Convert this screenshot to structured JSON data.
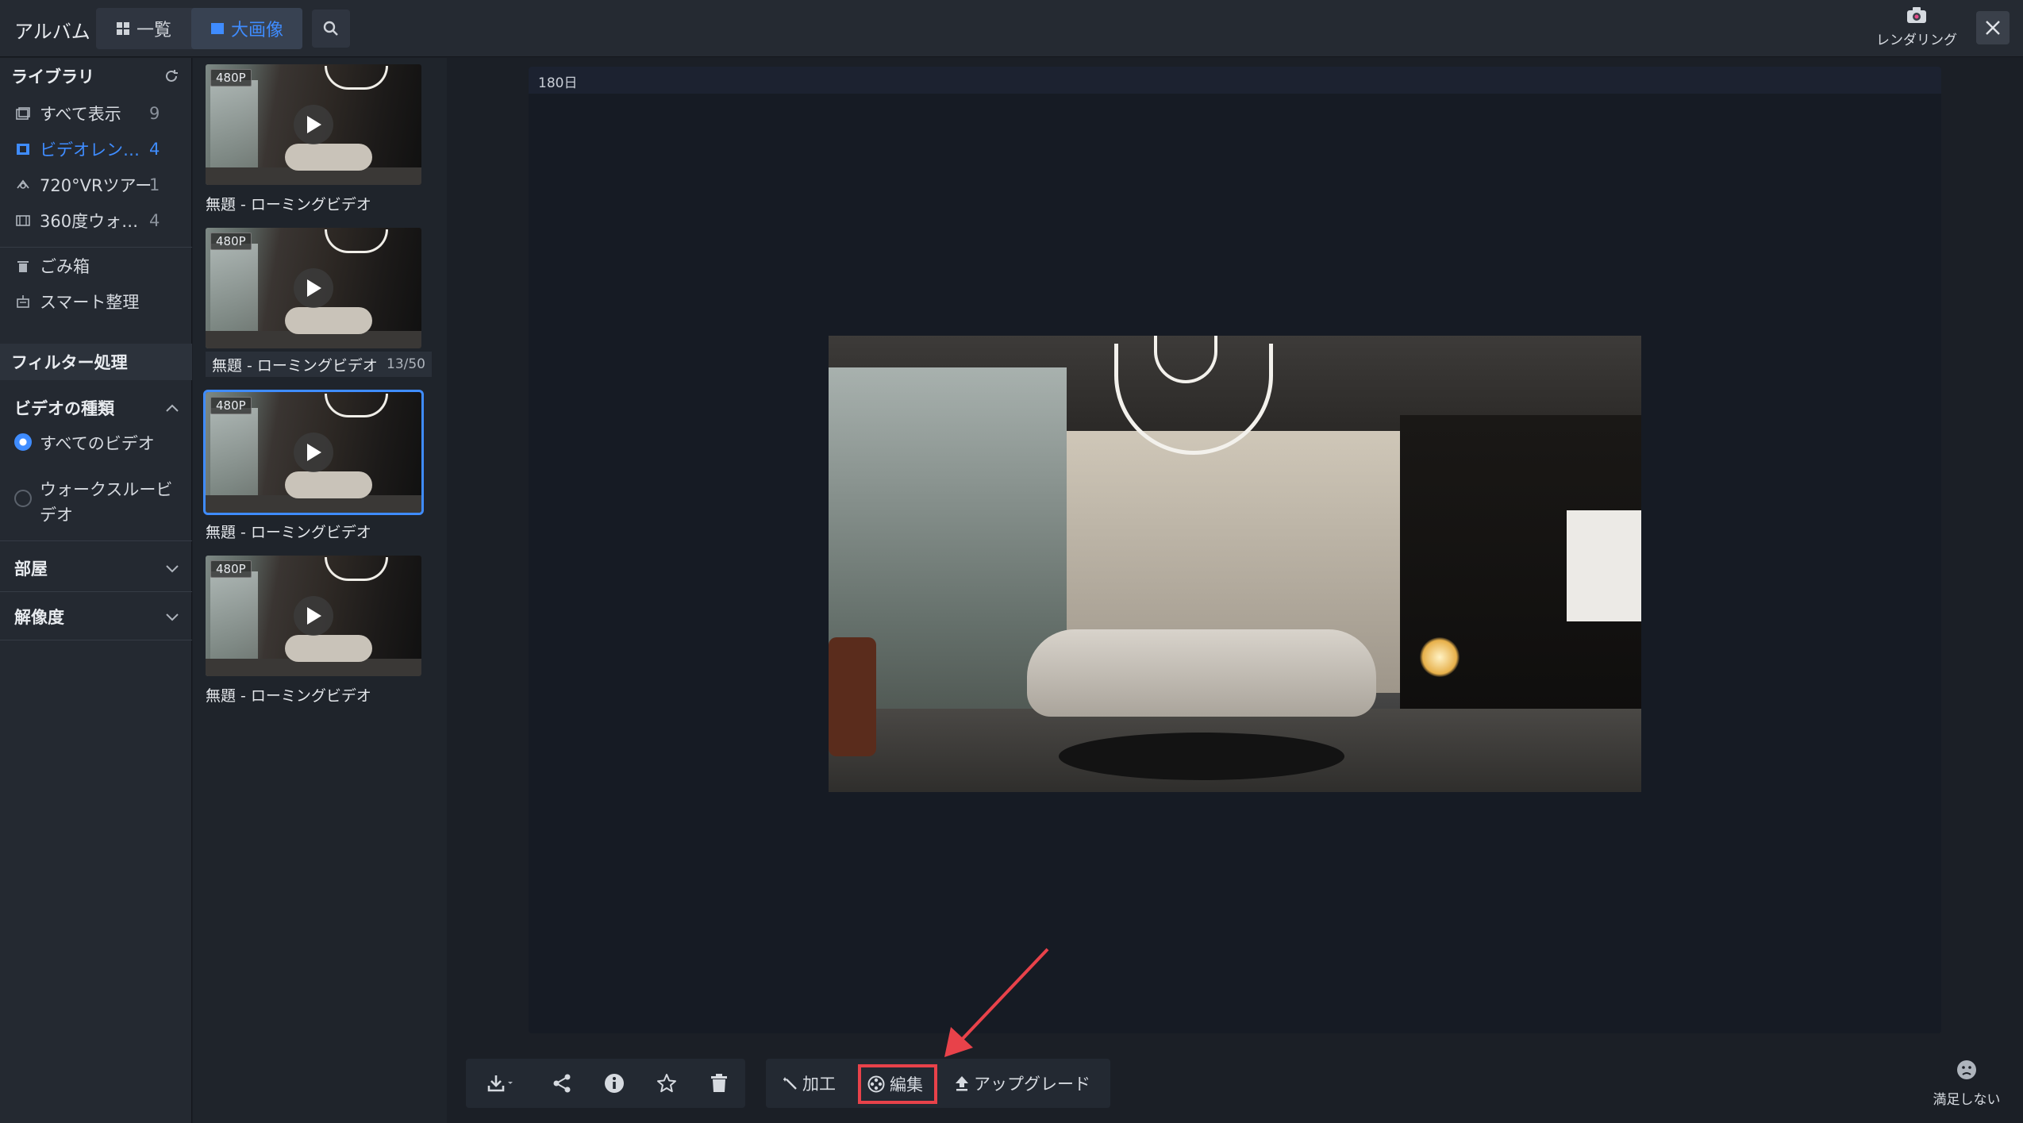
{
  "header": {
    "app_title": "アルバム",
    "view_list_label": "一覧",
    "view_large_label": "大画像",
    "render_label": "レンダリング"
  },
  "sidebar": {
    "library_title": "ライブラリ",
    "library_items": [
      {
        "label": "すべて表示",
        "count": "9",
        "icon": "images-icon"
      },
      {
        "label": "ビデオレン…",
        "count": "4",
        "icon": "film-icon",
        "active": true
      },
      {
        "label": "720°VRツアー",
        "count": "1",
        "icon": "vr-icon"
      },
      {
        "label": "360度ウォ…",
        "count": "4",
        "icon": "panorama-icon"
      }
    ],
    "trash_label": "ごみ箱",
    "smart_label": "スマート整理",
    "filter_title": "フィルター処理",
    "video_type_title": "ビデオの種類",
    "video_type_options": [
      "すべてのビデオ",
      "ウォークスルービデオ"
    ],
    "video_type_selected": "すべてのビデオ",
    "room_title": "部屋",
    "resolution_title": "解像度"
  },
  "thumbnails": [
    {
      "badge": "480P",
      "title": "無題 - ローミングビデオ",
      "page": ""
    },
    {
      "badge": "480P",
      "title": "無題 - ローミングビデオ",
      "page": "13/50"
    },
    {
      "badge": "480P",
      "title": "無題 - ローミングビデオ",
      "page": "",
      "selected": true
    },
    {
      "badge": "480P",
      "title": "無題 - ローミングビデオ",
      "page": ""
    }
  ],
  "viewer": {
    "label": "180日"
  },
  "toolbar": {
    "process_label": "加工",
    "edit_label": "編集",
    "upgrade_label": "アップグレード"
  },
  "feedback": {
    "label": "満足しない"
  },
  "colors": {
    "accent": "#3f8cff",
    "highlight": "#e8424a",
    "background": "#1b1f26"
  }
}
